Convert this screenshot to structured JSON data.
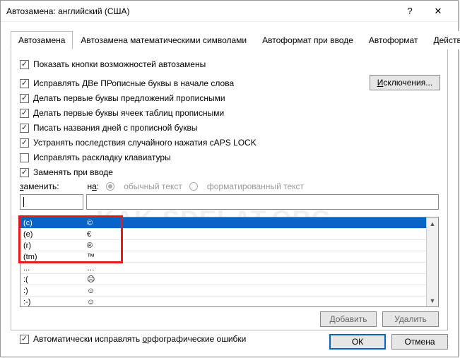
{
  "title": "Автозамена: английский (США)",
  "help_icon": "?",
  "close_icon": "✕",
  "tabs": [
    "Автозамена",
    "Автозамена математическими символами",
    "Автоформат при вводе",
    "Автоформат",
    "Действия"
  ],
  "options": {
    "show_buttons": "Показать кнопки возможностей автозамены",
    "fix_two_caps": "Исправлять ДВе ПРописные буквы в начале слова",
    "cap_sentence": "Делать первые буквы предложений прописными",
    "cap_cells": "Делать первые буквы ячеек таблиц прописными",
    "cap_days": "Писать названия дней с прописной буквы",
    "fix_capslock": "Устранять последствия случайного нажатия cAPS LOCK",
    "fix_layout": "Исправлять раскладку клавиатуры",
    "replace_on_type": "Заменять при вводе"
  },
  "exceptions_btn": "Исключения...",
  "labels": {
    "replace": "заменить:",
    "with": "на:",
    "plain": "обычный текст",
    "formatted": "форматированный текст"
  },
  "list": [
    {
      "a": "(c)",
      "b": "©"
    },
    {
      "a": "(e)",
      "b": "€"
    },
    {
      "a": "(r)",
      "b": "®"
    },
    {
      "a": "(tm)",
      "b": "™"
    },
    {
      "a": "...",
      "b": "…"
    },
    {
      "a": ":(",
      "b": "☹"
    },
    {
      "a": ":)",
      "b": "☺"
    },
    {
      "a": ":-)",
      "b": "☺"
    }
  ],
  "watermark": "KAK-SDELAT.ORG",
  "btn_add": "Добавить",
  "btn_delete": "Удалить",
  "auto_spell": "Автоматически исправлять орфографические ошибки",
  "btn_ok": "ОК",
  "btn_cancel": "Отмена"
}
